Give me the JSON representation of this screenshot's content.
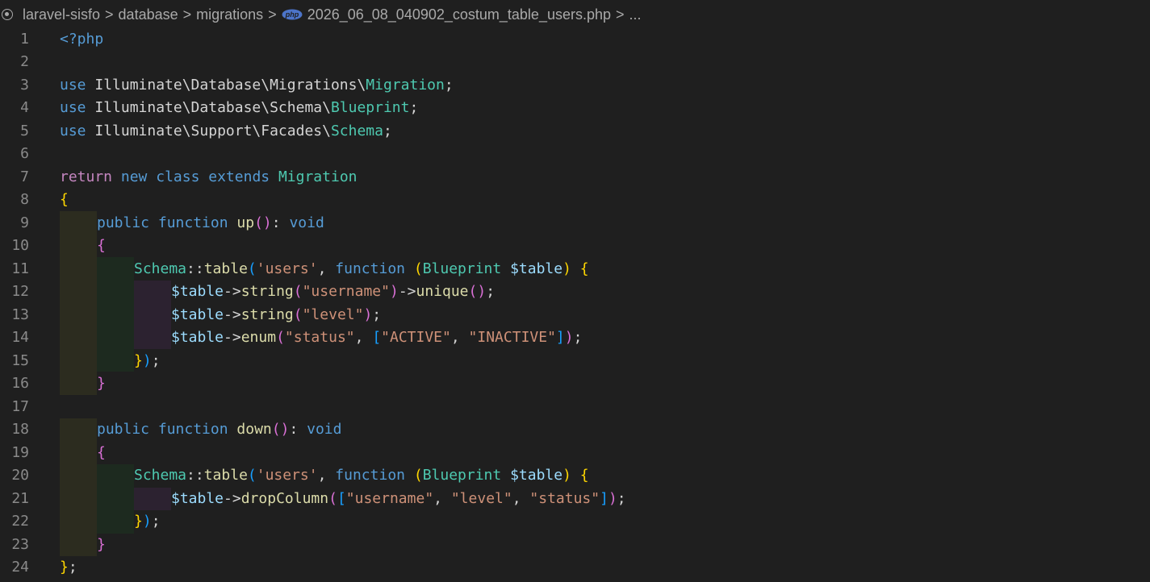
{
  "breadcrumb": {
    "project": "laravel-sisfo",
    "folder1": "database",
    "folder2": "migrations",
    "file": "2026_06_08_040902_costum_table_users.php",
    "more": "...",
    "separator": ">",
    "php_icon_label": "php"
  },
  "line_numbers": [
    "1",
    "2",
    "3",
    "4",
    "5",
    "6",
    "7",
    "8",
    "9",
    "10",
    "11",
    "12",
    "13",
    "14",
    "15",
    "16",
    "17",
    "18",
    "19",
    "20",
    "21",
    "22",
    "23",
    "24"
  ],
  "code": {
    "l1": {
      "open_tag": "<?php"
    },
    "l3": {
      "use": "use",
      "ns": " Illuminate\\Database\\Migrations\\",
      "cls": "Migration",
      "end": ";"
    },
    "l4": {
      "use": "use",
      "ns": " Illuminate\\Database\\Schema\\",
      "cls": "Blueprint",
      "end": ";"
    },
    "l5": {
      "use": "use",
      "ns": " Illuminate\\Support\\Facades\\",
      "cls": "Schema",
      "end": ";"
    },
    "l7": {
      "ret": "return",
      "new": " new",
      "class": " class",
      "extends": " extends",
      "cls": " Migration"
    },
    "l8": {
      "brace": "{"
    },
    "l9": {
      "public": "public",
      "function": " function",
      "name": " up",
      "paren": "()",
      "colon": ":",
      "void": " void"
    },
    "l10": {
      "brace": "{"
    },
    "l11": {
      "schema": "Schema",
      "sep": "::",
      "fn": "table",
      "p1": "(",
      "str": "'users'",
      "comma": ", ",
      "function": "function",
      "sp": " ",
      "p2": "(",
      "bp": "Blueprint",
      "var": " $table",
      "p3": ")",
      "sp2": " ",
      "brace": "{"
    },
    "l12": {
      "var": "$table",
      "arrow": "->",
      "fn": "string",
      "p1": "(",
      "str": "\"username\"",
      "p2": ")",
      "arrow2": "->",
      "fn2": "unique",
      "p3": "()",
      "end": ";"
    },
    "l13": {
      "var": "$table",
      "arrow": "->",
      "fn": "string",
      "p1": "(",
      "str": "\"level\"",
      "p2": ")",
      "end": ";"
    },
    "l14": {
      "var": "$table",
      "arrow": "->",
      "fn": "enum",
      "p1": "(",
      "str": "\"status\"",
      "comma": ", ",
      "br1": "[",
      "s1": "\"ACTIVE\"",
      "comma2": ", ",
      "s2": "\"INACTIVE\"",
      "br2": "]",
      "p2": ")",
      "end": ";"
    },
    "l15": {
      "brace": "}",
      "paren": ")",
      "end": ";"
    },
    "l16": {
      "brace": "}"
    },
    "l18": {
      "public": "public",
      "function": " function",
      "name": " down",
      "paren": "()",
      "colon": ":",
      "void": " void"
    },
    "l19": {
      "brace": "{"
    },
    "l20": {
      "schema": "Schema",
      "sep": "::",
      "fn": "table",
      "p1": "(",
      "str": "'users'",
      "comma": ", ",
      "function": "function",
      "sp": " ",
      "p2": "(",
      "bp": "Blueprint",
      "var": " $table",
      "p3": ")",
      "sp2": " ",
      "brace": "{"
    },
    "l21": {
      "var": "$table",
      "arrow": "->",
      "fn": "dropColumn",
      "p1": "(",
      "br1": "[",
      "s1": "\"username\"",
      "c1": ", ",
      "s2": "\"level\"",
      "c2": ", ",
      "s3": "\"status\"",
      "br2": "]",
      "p2": ")",
      "end": ";"
    },
    "l22": {
      "brace": "}",
      "paren": ")",
      "end": ";"
    },
    "l23": {
      "brace": "}"
    },
    "l24": {
      "brace": "}",
      "end": ";"
    }
  }
}
